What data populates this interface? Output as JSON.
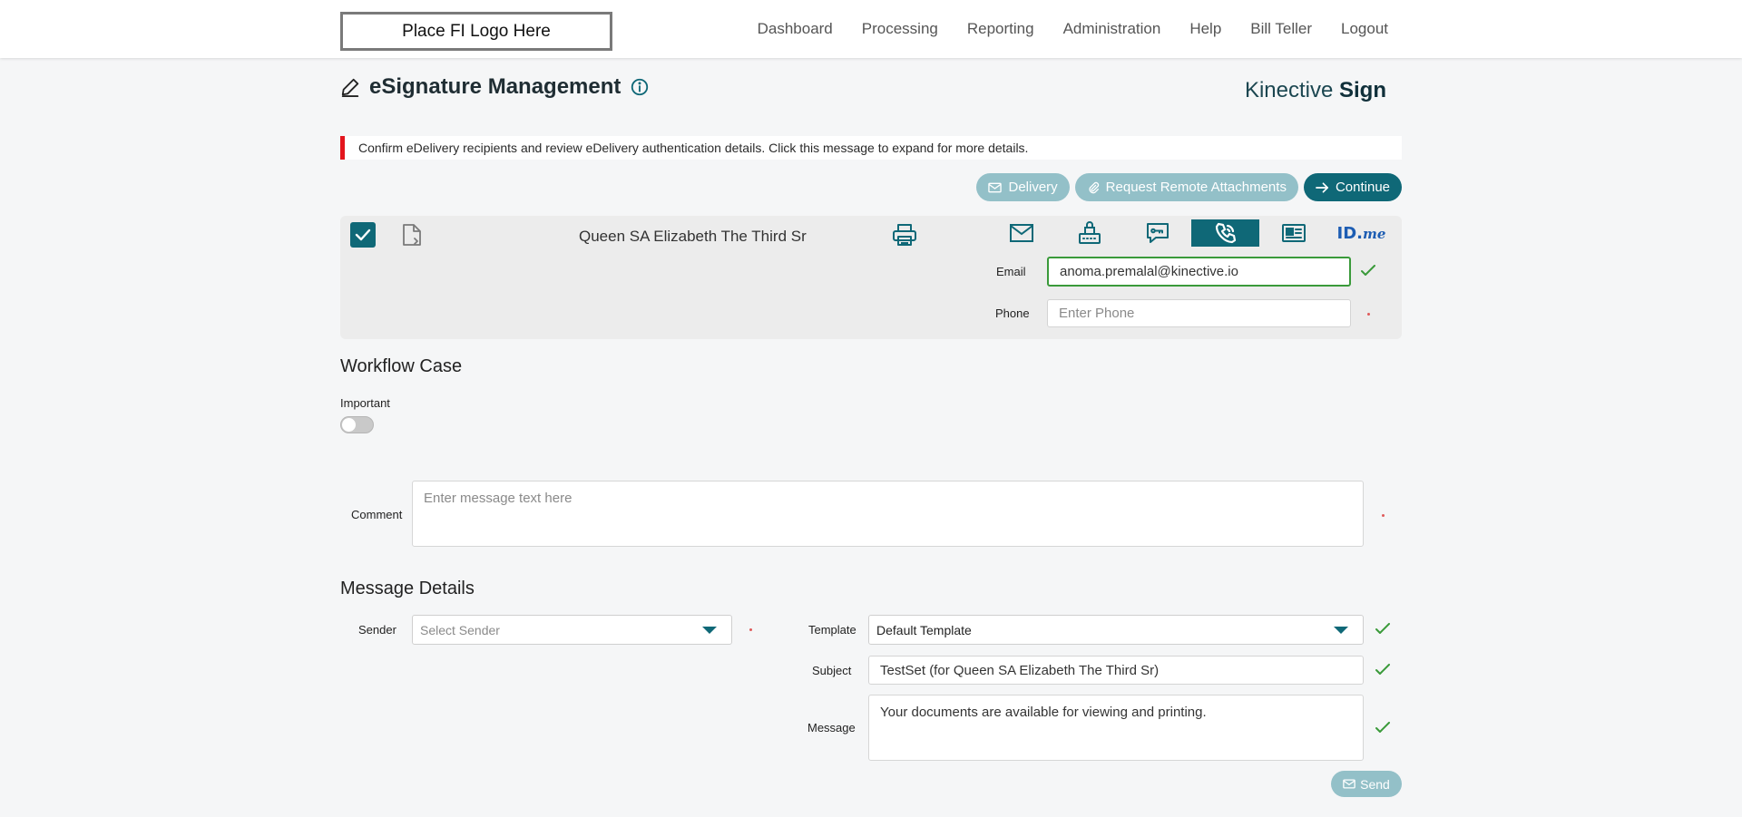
{
  "header": {
    "logo_text": "Place FI Logo Here",
    "nav": [
      "Dashboard",
      "Processing",
      "Reporting",
      "Administration",
      "Help",
      "Bill Teller",
      "Logout"
    ]
  },
  "page": {
    "title": "eSignature Management",
    "brand_light": "Kinective",
    "brand_bold": "Sign"
  },
  "alert": {
    "text": "Confirm eDelivery recipients and review eDelivery authentication details. Click this message to expand for more details."
  },
  "actions": {
    "delivery": "Delivery",
    "request_attachments": "Request Remote Attachments",
    "continue": "Continue"
  },
  "recipient": {
    "name": "Queen SA Elizabeth The Third Sr",
    "checked": true,
    "methods": [
      "email-icon",
      "fax-icon",
      "sms-icon",
      "phone-icon",
      "id-card-icon",
      "idme-logo"
    ],
    "active_method": "phone-icon",
    "idme_bold": "ID.",
    "idme_italic": "me",
    "email_label": "Email",
    "email_value": "anoma.premalal@kinective.io",
    "phone_label": "Phone",
    "phone_placeholder": "Enter Phone"
  },
  "workflow": {
    "heading": "Workflow Case",
    "important_label": "Important",
    "important_on": false,
    "comment_label": "Comment",
    "comment_placeholder": "Enter message text here"
  },
  "message": {
    "heading": "Message Details",
    "sender_label": "Sender",
    "sender_placeholder": "Select Sender",
    "template_label": "Template",
    "template_value": "Default Template",
    "subject_label": "Subject",
    "subject_value": "TestSet (for Queen SA Elizabeth The Third Sr)",
    "message_label": "Message",
    "message_value": "Your documents are available for viewing and printing.",
    "send": "Send"
  },
  "colors": {
    "accent": "#0f6877",
    "accent_light": "#93c0c8",
    "alert": "#e3151d",
    "success": "#3a9a3a"
  }
}
